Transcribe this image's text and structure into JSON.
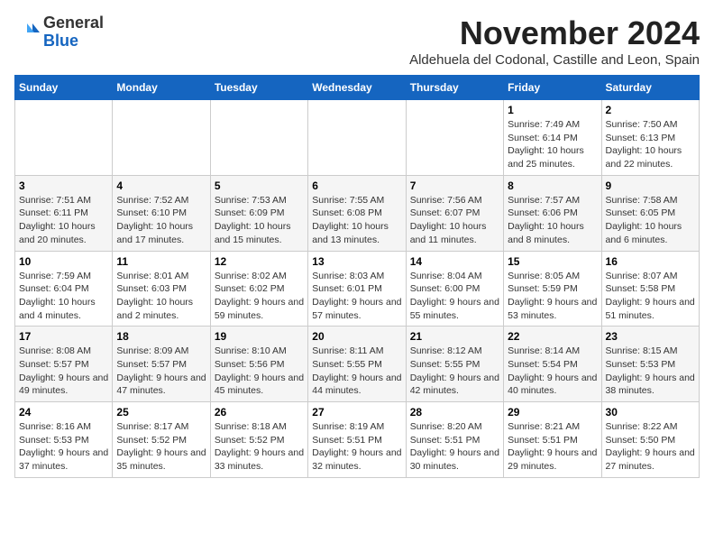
{
  "logo": {
    "general": "General",
    "blue": "Blue"
  },
  "header": {
    "month": "November 2024",
    "location": "Aldehuela del Codonal, Castille and Leon, Spain"
  },
  "days_of_week": [
    "Sunday",
    "Monday",
    "Tuesday",
    "Wednesday",
    "Thursday",
    "Friday",
    "Saturday"
  ],
  "weeks": [
    [
      {
        "day": "",
        "info": ""
      },
      {
        "day": "",
        "info": ""
      },
      {
        "day": "",
        "info": ""
      },
      {
        "day": "",
        "info": ""
      },
      {
        "day": "",
        "info": ""
      },
      {
        "day": "1",
        "info": "Sunrise: 7:49 AM\nSunset: 6:14 PM\nDaylight: 10 hours and 25 minutes."
      },
      {
        "day": "2",
        "info": "Sunrise: 7:50 AM\nSunset: 6:13 PM\nDaylight: 10 hours and 22 minutes."
      }
    ],
    [
      {
        "day": "3",
        "info": "Sunrise: 7:51 AM\nSunset: 6:11 PM\nDaylight: 10 hours and 20 minutes."
      },
      {
        "day": "4",
        "info": "Sunrise: 7:52 AM\nSunset: 6:10 PM\nDaylight: 10 hours and 17 minutes."
      },
      {
        "day": "5",
        "info": "Sunrise: 7:53 AM\nSunset: 6:09 PM\nDaylight: 10 hours and 15 minutes."
      },
      {
        "day": "6",
        "info": "Sunrise: 7:55 AM\nSunset: 6:08 PM\nDaylight: 10 hours and 13 minutes."
      },
      {
        "day": "7",
        "info": "Sunrise: 7:56 AM\nSunset: 6:07 PM\nDaylight: 10 hours and 11 minutes."
      },
      {
        "day": "8",
        "info": "Sunrise: 7:57 AM\nSunset: 6:06 PM\nDaylight: 10 hours and 8 minutes."
      },
      {
        "day": "9",
        "info": "Sunrise: 7:58 AM\nSunset: 6:05 PM\nDaylight: 10 hours and 6 minutes."
      }
    ],
    [
      {
        "day": "10",
        "info": "Sunrise: 7:59 AM\nSunset: 6:04 PM\nDaylight: 10 hours and 4 minutes."
      },
      {
        "day": "11",
        "info": "Sunrise: 8:01 AM\nSunset: 6:03 PM\nDaylight: 10 hours and 2 minutes."
      },
      {
        "day": "12",
        "info": "Sunrise: 8:02 AM\nSunset: 6:02 PM\nDaylight: 9 hours and 59 minutes."
      },
      {
        "day": "13",
        "info": "Sunrise: 8:03 AM\nSunset: 6:01 PM\nDaylight: 9 hours and 57 minutes."
      },
      {
        "day": "14",
        "info": "Sunrise: 8:04 AM\nSunset: 6:00 PM\nDaylight: 9 hours and 55 minutes."
      },
      {
        "day": "15",
        "info": "Sunrise: 8:05 AM\nSunset: 5:59 PM\nDaylight: 9 hours and 53 minutes."
      },
      {
        "day": "16",
        "info": "Sunrise: 8:07 AM\nSunset: 5:58 PM\nDaylight: 9 hours and 51 minutes."
      }
    ],
    [
      {
        "day": "17",
        "info": "Sunrise: 8:08 AM\nSunset: 5:57 PM\nDaylight: 9 hours and 49 minutes."
      },
      {
        "day": "18",
        "info": "Sunrise: 8:09 AM\nSunset: 5:57 PM\nDaylight: 9 hours and 47 minutes."
      },
      {
        "day": "19",
        "info": "Sunrise: 8:10 AM\nSunset: 5:56 PM\nDaylight: 9 hours and 45 minutes."
      },
      {
        "day": "20",
        "info": "Sunrise: 8:11 AM\nSunset: 5:55 PM\nDaylight: 9 hours and 44 minutes."
      },
      {
        "day": "21",
        "info": "Sunrise: 8:12 AM\nSunset: 5:55 PM\nDaylight: 9 hours and 42 minutes."
      },
      {
        "day": "22",
        "info": "Sunrise: 8:14 AM\nSunset: 5:54 PM\nDaylight: 9 hours and 40 minutes."
      },
      {
        "day": "23",
        "info": "Sunrise: 8:15 AM\nSunset: 5:53 PM\nDaylight: 9 hours and 38 minutes."
      }
    ],
    [
      {
        "day": "24",
        "info": "Sunrise: 8:16 AM\nSunset: 5:53 PM\nDaylight: 9 hours and 37 minutes."
      },
      {
        "day": "25",
        "info": "Sunrise: 8:17 AM\nSunset: 5:52 PM\nDaylight: 9 hours and 35 minutes."
      },
      {
        "day": "26",
        "info": "Sunrise: 8:18 AM\nSunset: 5:52 PM\nDaylight: 9 hours and 33 minutes."
      },
      {
        "day": "27",
        "info": "Sunrise: 8:19 AM\nSunset: 5:51 PM\nDaylight: 9 hours and 32 minutes."
      },
      {
        "day": "28",
        "info": "Sunrise: 8:20 AM\nSunset: 5:51 PM\nDaylight: 9 hours and 30 minutes."
      },
      {
        "day": "29",
        "info": "Sunrise: 8:21 AM\nSunset: 5:51 PM\nDaylight: 9 hours and 29 minutes."
      },
      {
        "day": "30",
        "info": "Sunrise: 8:22 AM\nSunset: 5:50 PM\nDaylight: 9 hours and 27 minutes."
      }
    ]
  ]
}
